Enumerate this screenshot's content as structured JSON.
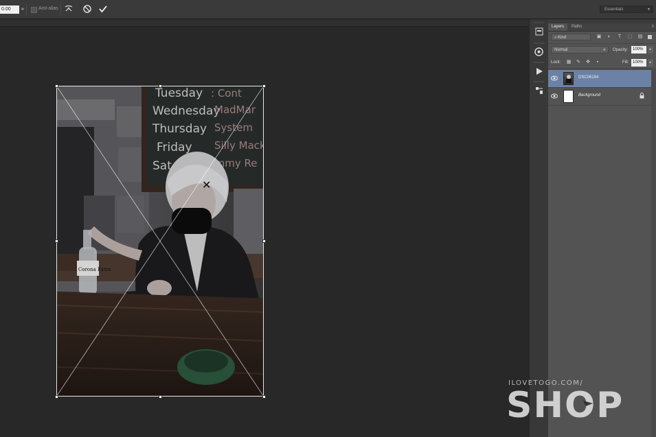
{
  "options_bar": {
    "value_field": "0.00",
    "antialias_label": "Anti-alias",
    "workspace_label": "Essentials"
  },
  "panel": {
    "tabs": [
      "Layers",
      "Paths"
    ],
    "filter_kind": "Kind",
    "blend_mode": "Normal",
    "opacity_label": "Opacity:",
    "opacity_value": "100%",
    "lock_label": "Lock:",
    "fill_label": "Fill:",
    "fill_value": "100%",
    "layers": [
      {
        "name": "DSC06194",
        "selected": true
      },
      {
        "name": "Background",
        "selected": false,
        "locked": true
      }
    ]
  },
  "photo": {
    "board_lines": [
      "Tuesday: Cont",
      "Wednesday: MadMar",
      "Thursday: System",
      "Friday: SillyMack",
      "Sat Jimmy Re"
    ],
    "bottle_label": "Corona Extra"
  },
  "watermark": {
    "site": "ILOVETOGO.COM/",
    "word": "SHOP"
  },
  "colors": {
    "workspace_bg": "#282828",
    "panel_bg": "#535353",
    "selected_layer": "#6b82a6"
  }
}
